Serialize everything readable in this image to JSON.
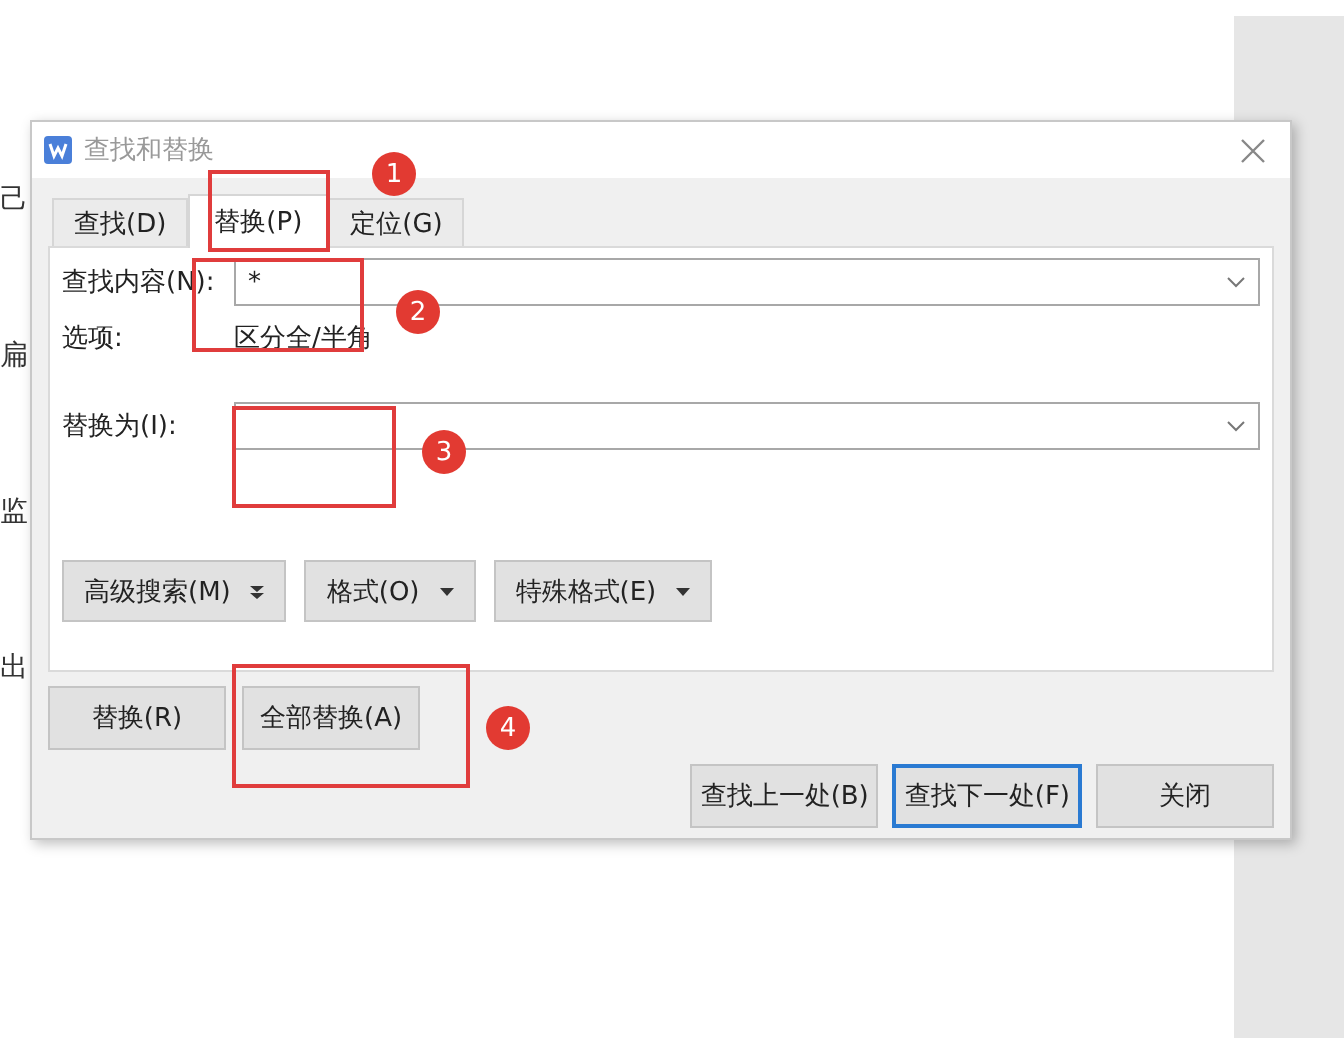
{
  "document": {
    "fragments": [
      "己",
      "扁",
      "监",
      "出"
    ]
  },
  "window": {
    "title": "查找和替换"
  },
  "tabs": [
    {
      "label": "查找(D)",
      "selected": false
    },
    {
      "label": "替换(P)",
      "selected": true
    },
    {
      "label": "定位(G)",
      "selected": false
    }
  ],
  "find_field": {
    "label": "查找内容(N):",
    "value": "*"
  },
  "options": {
    "label": "选项:",
    "value": "区分全/半角"
  },
  "replace_field": {
    "label": "替换为(I):"
  },
  "panel_buttons": [
    {
      "label": "高级搜索(M)",
      "kind": "double"
    },
    {
      "label": "格式(O)",
      "kind": "menu"
    },
    {
      "label": "特殊格式(E)",
      "kind": "menu"
    }
  ],
  "replace_buttons": [
    "替换(R)",
    "全部替换(A)"
  ],
  "footer_buttons": [
    {
      "label": "查找上一处(B)",
      "selected": false
    },
    {
      "label": "查找下一处(F)",
      "selected": true
    },
    {
      "label": "关闭",
      "selected": false
    }
  ],
  "annotations": [
    "1",
    "2",
    "3",
    "4"
  ]
}
